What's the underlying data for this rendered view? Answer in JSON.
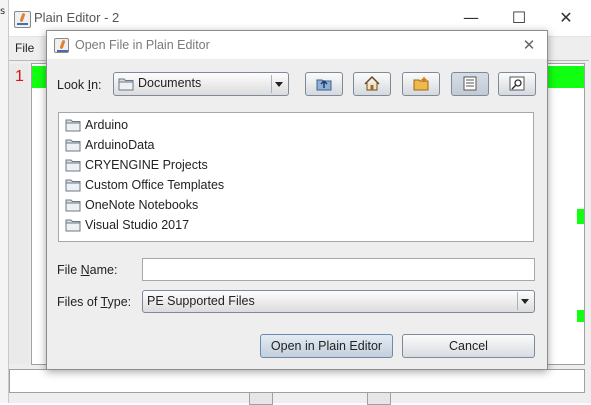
{
  "main_window": {
    "title": "Plain Editor - 2",
    "menu": {
      "file_label": "File"
    },
    "line_number": "1",
    "controls": {
      "minimize": "—",
      "maximize": "☐",
      "close": "✕"
    }
  },
  "dialog": {
    "title": "Open File in Plain Editor",
    "close_glyph": "✕",
    "look_in": {
      "label_pre": "Look ",
      "label_mnemonic": "I",
      "label_post": "n:",
      "value": "Documents"
    },
    "toolbar": {
      "up_one_level_icon": "up-folder-icon",
      "home_icon": "home-icon",
      "new_folder_icon": "new-folder-icon",
      "list_view_icon": "list-view-icon",
      "details_view_icon": "details-view-icon"
    },
    "files": [
      {
        "name": "Arduino"
      },
      {
        "name": "ArduinoData"
      },
      {
        "name": "CRYENGINE Projects"
      },
      {
        "name": "Custom Office Templates"
      },
      {
        "name": "OneNote Notebooks"
      },
      {
        "name": "Visual Studio 2017"
      }
    ],
    "file_name": {
      "label_pre": "File ",
      "label_mnemonic": "N",
      "label_post": "ame:",
      "value": ""
    },
    "files_of_type": {
      "label_pre": "Files of ",
      "label_mnemonic": "T",
      "label_post": "ype:",
      "value": "PE Supported Files"
    },
    "buttons": {
      "open": "Open in Plain Editor",
      "cancel": "Cancel"
    }
  },
  "colors": {
    "highlight_green": "#11ff11",
    "line_number_red": "#e01010",
    "dialog_bg": "#eeeeee"
  }
}
